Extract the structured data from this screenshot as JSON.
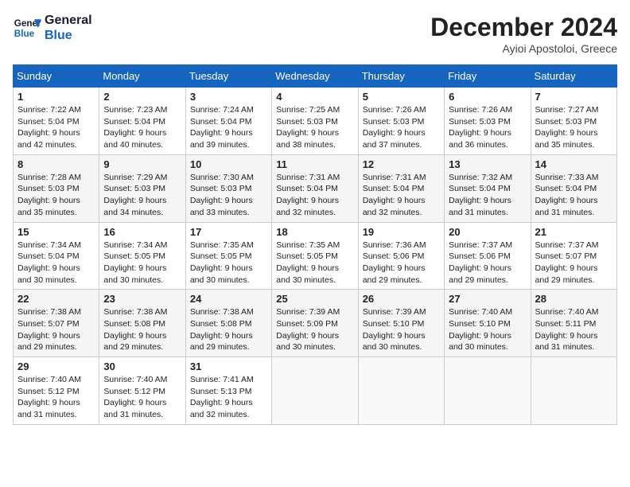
{
  "header": {
    "logo_line1": "General",
    "logo_line2": "Blue",
    "month_year": "December 2024",
    "location": "Ayioi Apostoloi, Greece"
  },
  "weekdays": [
    "Sunday",
    "Monday",
    "Tuesday",
    "Wednesday",
    "Thursday",
    "Friday",
    "Saturday"
  ],
  "weeks": [
    [
      {
        "day": "1",
        "info": "Sunrise: 7:22 AM\nSunset: 5:04 PM\nDaylight: 9 hours\nand 42 minutes."
      },
      {
        "day": "2",
        "info": "Sunrise: 7:23 AM\nSunset: 5:04 PM\nDaylight: 9 hours\nand 40 minutes."
      },
      {
        "day": "3",
        "info": "Sunrise: 7:24 AM\nSunset: 5:04 PM\nDaylight: 9 hours\nand 39 minutes."
      },
      {
        "day": "4",
        "info": "Sunrise: 7:25 AM\nSunset: 5:03 PM\nDaylight: 9 hours\nand 38 minutes."
      },
      {
        "day": "5",
        "info": "Sunrise: 7:26 AM\nSunset: 5:03 PM\nDaylight: 9 hours\nand 37 minutes."
      },
      {
        "day": "6",
        "info": "Sunrise: 7:26 AM\nSunset: 5:03 PM\nDaylight: 9 hours\nand 36 minutes."
      },
      {
        "day": "7",
        "info": "Sunrise: 7:27 AM\nSunset: 5:03 PM\nDaylight: 9 hours\nand 35 minutes."
      }
    ],
    [
      {
        "day": "8",
        "info": "Sunrise: 7:28 AM\nSunset: 5:03 PM\nDaylight: 9 hours\nand 35 minutes."
      },
      {
        "day": "9",
        "info": "Sunrise: 7:29 AM\nSunset: 5:03 PM\nDaylight: 9 hours\nand 34 minutes."
      },
      {
        "day": "10",
        "info": "Sunrise: 7:30 AM\nSunset: 5:03 PM\nDaylight: 9 hours\nand 33 minutes."
      },
      {
        "day": "11",
        "info": "Sunrise: 7:31 AM\nSunset: 5:04 PM\nDaylight: 9 hours\nand 32 minutes."
      },
      {
        "day": "12",
        "info": "Sunrise: 7:31 AM\nSunset: 5:04 PM\nDaylight: 9 hours\nand 32 minutes."
      },
      {
        "day": "13",
        "info": "Sunrise: 7:32 AM\nSunset: 5:04 PM\nDaylight: 9 hours\nand 31 minutes."
      },
      {
        "day": "14",
        "info": "Sunrise: 7:33 AM\nSunset: 5:04 PM\nDaylight: 9 hours\nand 31 minutes."
      }
    ],
    [
      {
        "day": "15",
        "info": "Sunrise: 7:34 AM\nSunset: 5:04 PM\nDaylight: 9 hours\nand 30 minutes."
      },
      {
        "day": "16",
        "info": "Sunrise: 7:34 AM\nSunset: 5:05 PM\nDaylight: 9 hours\nand 30 minutes."
      },
      {
        "day": "17",
        "info": "Sunrise: 7:35 AM\nSunset: 5:05 PM\nDaylight: 9 hours\nand 30 minutes."
      },
      {
        "day": "18",
        "info": "Sunrise: 7:35 AM\nSunset: 5:05 PM\nDaylight: 9 hours\nand 30 minutes."
      },
      {
        "day": "19",
        "info": "Sunrise: 7:36 AM\nSunset: 5:06 PM\nDaylight: 9 hours\nand 29 minutes."
      },
      {
        "day": "20",
        "info": "Sunrise: 7:37 AM\nSunset: 5:06 PM\nDaylight: 9 hours\nand 29 minutes."
      },
      {
        "day": "21",
        "info": "Sunrise: 7:37 AM\nSunset: 5:07 PM\nDaylight: 9 hours\nand 29 minutes."
      }
    ],
    [
      {
        "day": "22",
        "info": "Sunrise: 7:38 AM\nSunset: 5:07 PM\nDaylight: 9 hours\nand 29 minutes."
      },
      {
        "day": "23",
        "info": "Sunrise: 7:38 AM\nSunset: 5:08 PM\nDaylight: 9 hours\nand 29 minutes."
      },
      {
        "day": "24",
        "info": "Sunrise: 7:38 AM\nSunset: 5:08 PM\nDaylight: 9 hours\nand 29 minutes."
      },
      {
        "day": "25",
        "info": "Sunrise: 7:39 AM\nSunset: 5:09 PM\nDaylight: 9 hours\nand 30 minutes."
      },
      {
        "day": "26",
        "info": "Sunrise: 7:39 AM\nSunset: 5:10 PM\nDaylight: 9 hours\nand 30 minutes."
      },
      {
        "day": "27",
        "info": "Sunrise: 7:40 AM\nSunset: 5:10 PM\nDaylight: 9 hours\nand 30 minutes."
      },
      {
        "day": "28",
        "info": "Sunrise: 7:40 AM\nSunset: 5:11 PM\nDaylight: 9 hours\nand 31 minutes."
      }
    ],
    [
      {
        "day": "29",
        "info": "Sunrise: 7:40 AM\nSunset: 5:12 PM\nDaylight: 9 hours\nand 31 minutes."
      },
      {
        "day": "30",
        "info": "Sunrise: 7:40 AM\nSunset: 5:12 PM\nDaylight: 9 hours\nand 31 minutes."
      },
      {
        "day": "31",
        "info": "Sunrise: 7:41 AM\nSunset: 5:13 PM\nDaylight: 9 hours\nand 32 minutes."
      },
      {
        "day": "",
        "info": ""
      },
      {
        "day": "",
        "info": ""
      },
      {
        "day": "",
        "info": ""
      },
      {
        "day": "",
        "info": ""
      }
    ]
  ]
}
